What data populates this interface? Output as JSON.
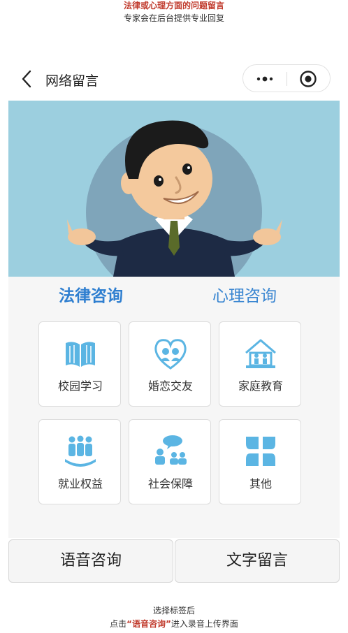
{
  "captions": {
    "top_line1": "法律或心理方面的问题留言",
    "top_line2": "专家会在后台提供专业回复",
    "bottom_line1": "选择标签后",
    "bottom_line2_pre": "点击",
    "bottom_line2_hl": "“语音咨询”",
    "bottom_line2_post": "进入录音上传界面"
  },
  "navbar": {
    "title": "网络留言",
    "back_icon": "chevron-left-icon",
    "more_icon": "more-dots-icon",
    "close_icon": "target-close-icon"
  },
  "tabs": [
    {
      "label": "法律咨询",
      "active": true
    },
    {
      "label": "心理咨询",
      "active": false
    }
  ],
  "categories": [
    {
      "label": "校园学习",
      "icon": "book-icon"
    },
    {
      "label": "婚恋交友",
      "icon": "couple-heart-icon"
    },
    {
      "label": "家庭教育",
      "icon": "family-home-icon"
    },
    {
      "label": "就业权益",
      "icon": "people-group-icon"
    },
    {
      "label": "社会保障",
      "icon": "social-chat-icon"
    },
    {
      "label": "其他",
      "icon": "petals-icon"
    }
  ],
  "actions": {
    "voice_label": "语音咨询",
    "text_label": "文字留言"
  },
  "colors": {
    "accent_blue": "#2f7fd0",
    "icon_blue": "#5bb5e3",
    "highlight_red": "#c0392b"
  }
}
